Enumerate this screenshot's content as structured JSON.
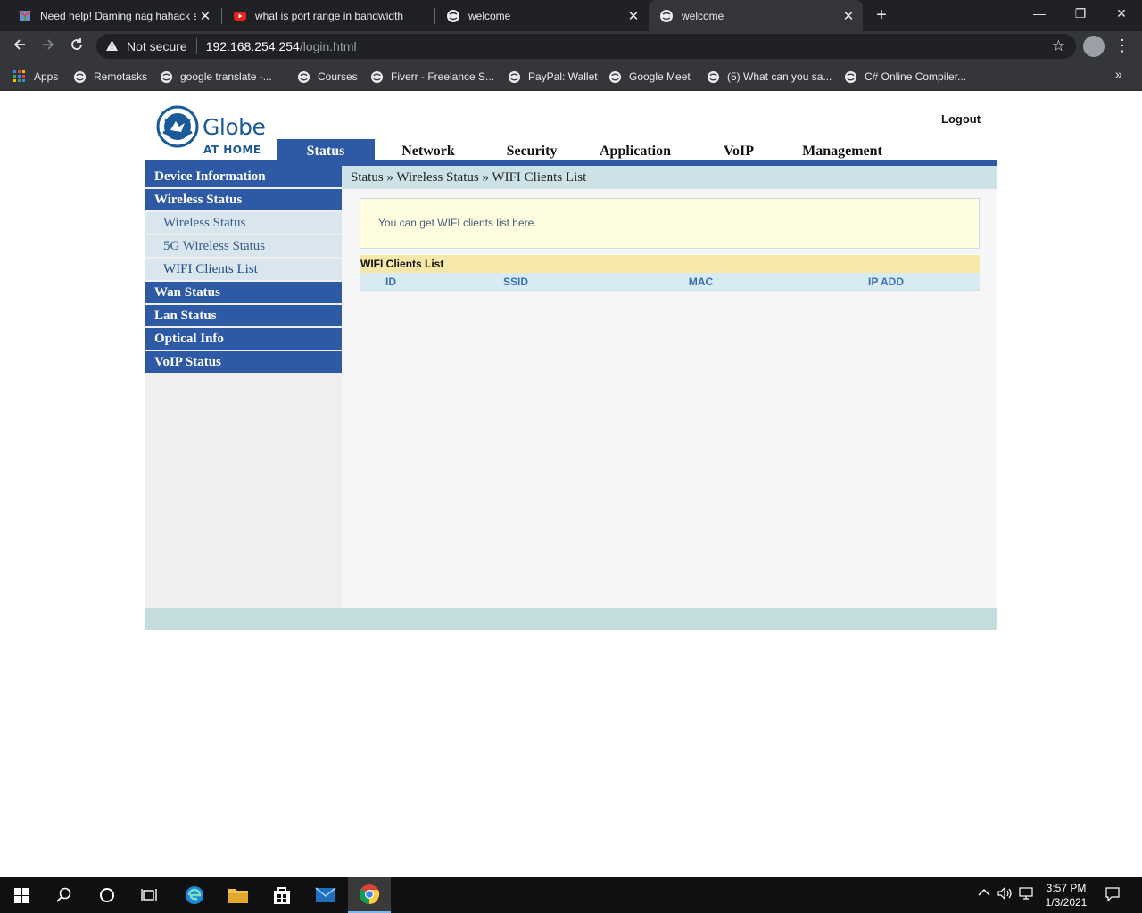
{
  "browser": {
    "tabs": [
      {
        "title": "Need help! Daming nag hahack s",
        "icon": "globe-rgb-icon",
        "active": false
      },
      {
        "title": "what is port range in bandwidth",
        "icon": "youtube-icon",
        "active": false
      },
      {
        "title": "welcome",
        "icon": "globe-icon",
        "active": false
      },
      {
        "title": "welcome",
        "icon": "globe-icon",
        "active": true
      }
    ],
    "close_glyph": "✕",
    "new_tab_glyph": "+",
    "window_controls": {
      "minimize": "—",
      "restore": "❐",
      "close": "✕"
    },
    "security_label": "Not secure",
    "url_host": "192.168.254.254",
    "url_path": "/login.html",
    "bookmarks": [
      "Apps",
      "Remotasks",
      "google translate -...",
      "Courses",
      "Fiverr - Freelance S...",
      "PayPal: Wallet",
      "Google Meet",
      "(5) What can you sa...",
      "C# Online Compiler..."
    ],
    "bookmarks_more": "»"
  },
  "router": {
    "brand": "Globe",
    "brand_sub": "AT HOME",
    "logout": "Logout",
    "nav": [
      "Status",
      "Network",
      "Security",
      "Application",
      "VoIP",
      "Management"
    ],
    "active_nav": "Status",
    "sidebar": [
      {
        "label": "Device Information",
        "type": "header"
      },
      {
        "label": "Wireless Status",
        "type": "header"
      },
      {
        "label": "Wireless Status",
        "type": "sub"
      },
      {
        "label": "5G Wireless Status",
        "type": "sub"
      },
      {
        "label": "WIFI Clients List",
        "type": "sub",
        "current": true
      },
      {
        "label": "Wan Status",
        "type": "header"
      },
      {
        "label": "Lan Status",
        "type": "header"
      },
      {
        "label": "Optical Info",
        "type": "header"
      },
      {
        "label": "VoIP Status",
        "type": "header"
      }
    ],
    "breadcrumb": "Status » Wireless Status » WIFI Clients List",
    "info": "You can get WIFI clients list here.",
    "table_title": "WIFI Clients List",
    "columns": [
      "ID",
      "SSID",
      "MAC",
      "IP ADD"
    ],
    "colors": {
      "primary": "#2e5aa5",
      "breadcrumb_bg": "#cde2e7",
      "info_bg": "#fffde0",
      "table_header_bg": "#f6e8a8",
      "column_bg": "#d9ebf2"
    }
  },
  "taskbar": {
    "time": "3:57 PM",
    "date": "1/3/2021"
  }
}
